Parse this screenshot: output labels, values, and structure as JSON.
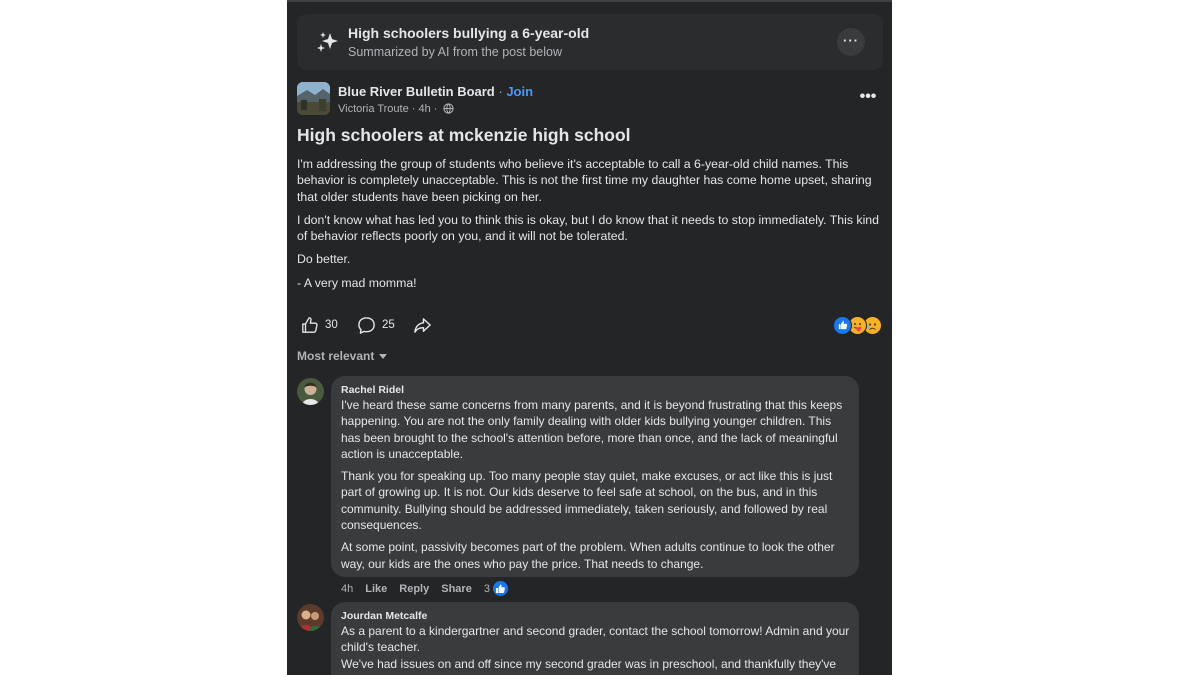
{
  "summary": {
    "title": "High schoolers bullying a 6-year-old",
    "subtitle": "Summarized by AI from the post below",
    "more_label": "···",
    "icon": "ai-sparkle-icon"
  },
  "post": {
    "group_name": "Blue River Bulletin Board",
    "separator": " · ",
    "join_label": "Join",
    "author": "Victoria Troute",
    "time": " · 4h · ",
    "more_label": "•••",
    "title": "High schoolers at mckenzie high school",
    "paragraphs": [
      "I'm addressing the group of students who believe it's acceptable to call a 6-year-old child names. This behavior is completely unacceptable. This is not the first time my daughter has come home upset, sharing that older students have been picking on her.",
      "I don't know what has led you to think this is okay, but I do know that it needs to stop immediately. This kind of behavior reflects poorly on you, and it will not be tolerated.",
      "Do better.",
      "- A very mad momma!"
    ],
    "like_count": "30",
    "comment_count": "25",
    "reaction_icons": [
      "like",
      "love",
      "care"
    ]
  },
  "comments_filter": "Most relevant",
  "comments": [
    {
      "author": "Rachel Ridel",
      "paragraphs": [
        "I've heard these same concerns from many parents, and it is beyond frustrating that this keeps happening. You are not the only family dealing with older kids bullying younger children. This has been brought to the school's attention before, more than once, and the lack of meaningful action is unacceptable.",
        "Thank you for speaking up. Too many people stay quiet, make excuses, or act like this is just part of growing up. It is not. Our kids deserve to feel safe at school, on the bus, and in this community. Bullying should be addressed immediately, taken seriously, and followed by real consequences.",
        "At some point, passivity becomes part of the problem. When adults continue to look the other way, our kids are the ones who pay the price. That needs to change."
      ],
      "time": "4h",
      "like_label": "Like",
      "reply_label": "Reply",
      "share_label": "Share",
      "reaction_count": "3"
    },
    {
      "author": "Jourdan Metcalfe",
      "paragraphs": [
        "As a parent to a kindergartner and second grader, contact the school tomorrow! Admin and your child's teacher.",
        "We've had issues on and off since my second grader was in preschool, and thankfully they've"
      ]
    }
  ],
  "colors": {
    "panel_bg": "#242526",
    "bubble_bg": "#3a3b3c",
    "text_primary": "#e4e6eb",
    "text_secondary": "#b0b3b8",
    "accent": "#4599ff"
  }
}
